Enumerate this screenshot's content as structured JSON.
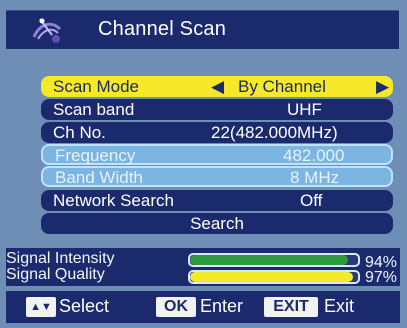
{
  "header": {
    "title": "Channel Scan",
    "icon": "satellite-dish-icon"
  },
  "menu": {
    "scan_mode": {
      "label": "Scan Mode",
      "value": "By Channel",
      "left_arrow": "◀",
      "right_arrow": "▶"
    },
    "scan_band": {
      "label": "Scan band",
      "value": "UHF"
    },
    "ch_no": {
      "label": "Ch No.",
      "value": "22(482.000MHz)"
    },
    "frequency": {
      "label": "Frequency",
      "value": "482.000"
    },
    "band_width": {
      "label": "Band Width",
      "value": "8 MHz"
    },
    "network_search": {
      "label": "Network Search",
      "value": "Off"
    },
    "search": {
      "label": "Search"
    }
  },
  "signal": {
    "intensity": {
      "label": "Signal Intensity",
      "value": "94%",
      "fraction": 0.94,
      "color": "#2f9a3c"
    },
    "quality": {
      "label": "Signal Quality",
      "value": "97%",
      "fraction": 0.97,
      "color": "#f3ea28"
    }
  },
  "footer": {
    "select_key": "▲▼",
    "select_label": "Select",
    "ok_key": "OK",
    "enter_label": "Enter",
    "exit_key": "EXIT",
    "exit_label": "Exit"
  },
  "colors": {
    "background": "#6f8eb6",
    "bar_navy": "#1b2a6c",
    "highlight": "#f6e92a",
    "disabled": "#7cb4e2"
  }
}
